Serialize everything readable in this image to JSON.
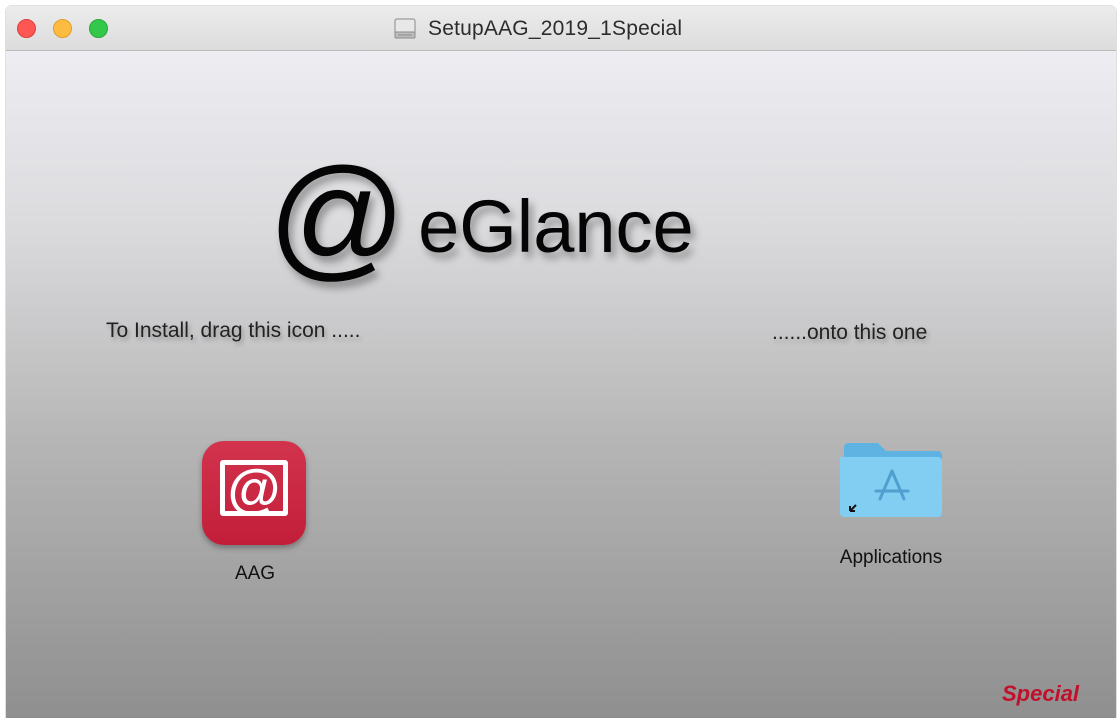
{
  "window": {
    "title": "SetupAAG_2019_1Special",
    "title_icon": "disk-image-icon"
  },
  "logo": {
    "at_symbol": "@",
    "text": "eGlance"
  },
  "instructions": {
    "left": "To Install, drag this icon .....",
    "right": "......onto this one"
  },
  "items": {
    "app": {
      "label": "AAG",
      "icon": "aag-app-icon",
      "icon_glyph": "@",
      "color": "#c8243f"
    },
    "folder": {
      "label": "Applications",
      "icon": "applications-folder-icon",
      "color": "#7cc7ee"
    }
  },
  "footer": {
    "special": "Special",
    "color": "#c2102a"
  }
}
